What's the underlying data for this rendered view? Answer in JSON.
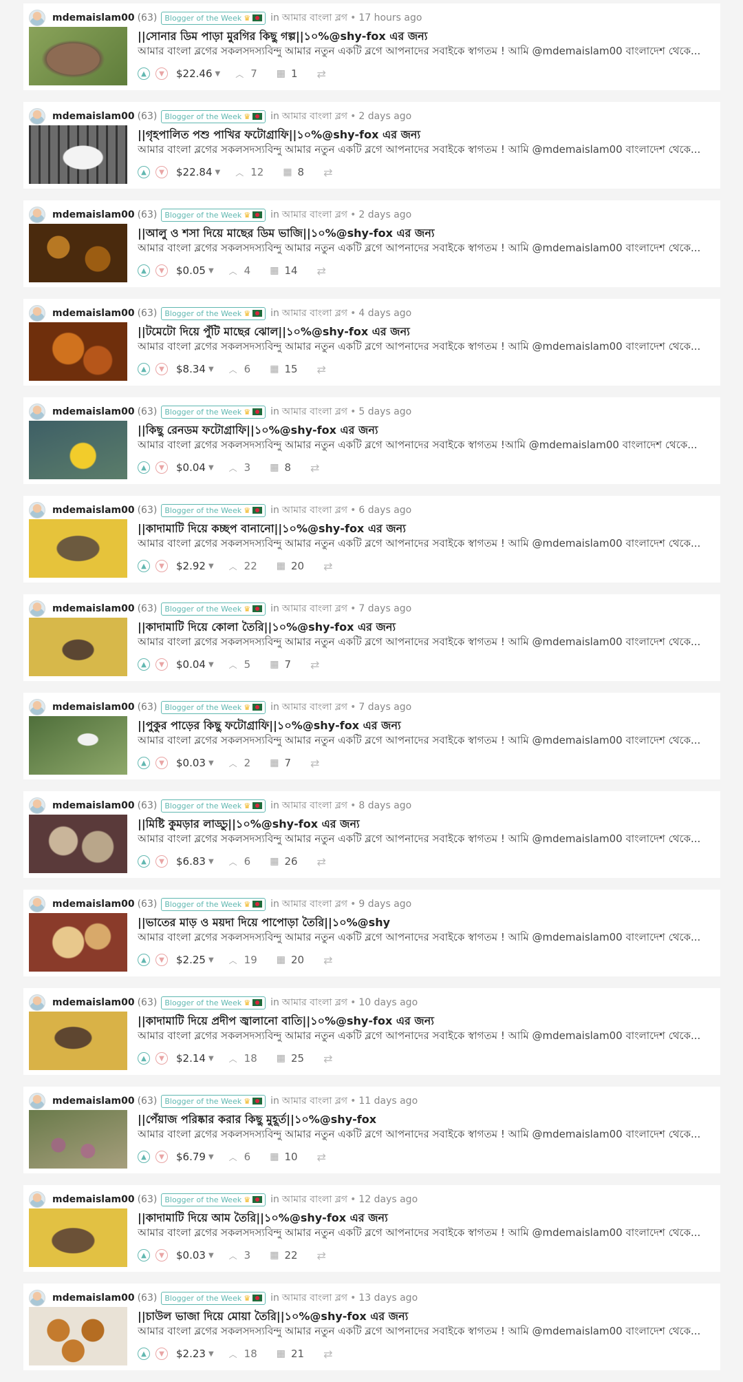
{
  "colors": {
    "accent": "#5fb7b0",
    "downvote": "#e9a5a5",
    "background": "#f4f4f4"
  },
  "icons": {
    "upvote": "chevron-up-icon",
    "downvote": "chevron-down-icon",
    "comments": "comment-icon",
    "reblog": "reblog-icon"
  },
  "posts": [
    {
      "author": "mdemaislam00",
      "rep": "(63)",
      "badge": "Blogger of the Week",
      "in": "in",
      "community": "আমার বাংলা ব্লগ",
      "time": "17 hours ago",
      "title": "||সোনার ডিম পাড়া মুরগির কিছু গল্প||১০%@shy-fox এর জন্য",
      "summary": "আমার বাংলা ব্লগের সকলসদস্যবিন্দু আমার নতুন একটি ব্লগে আপনাদের সবাইকে স্বাগতম ! আমি @mdemaislam00 বাংলাদেশ থেকে...",
      "payout": "$22.46",
      "votes": "7",
      "comments": "1"
    },
    {
      "author": "mdemaislam00",
      "rep": "(63)",
      "badge": "Blogger of the Week",
      "in": "in",
      "community": "আমার বাংলা ব্লগ",
      "time": "2 days ago",
      "title": "||গৃহপালিত পশু পাখির ফটোগ্রাফি||১০%@shy-fox এর জন্য",
      "summary": "আমার বাংলা ব্লগের সকলসদস্যবিন্দু আমার নতুন একটি ব্লগে আপনাদের সবাইকে স্বাগতম ! আমি @mdemaislam00 বাংলাদেশ থেকে...",
      "payout": "$22.84",
      "votes": "12",
      "comments": "8"
    },
    {
      "author": "mdemaislam00",
      "rep": "(63)",
      "badge": "Blogger of the Week",
      "in": "in",
      "community": "আমার বাংলা ব্লগ",
      "time": "2 days ago",
      "title": "||আলু ও শসা দিয়ে মাছের ডিম ভাজি||১০%@shy-fox এর জন্য",
      "summary": "আমার বাংলা ব্লগের সকলসদস্যবিন্দু আমার নতুন একটি ব্লগে আপনাদের সবাইকে স্বাগতম ! আমি @mdemaislam00 বাংলাদেশ থেকে...",
      "payout": "$0.05",
      "votes": "4",
      "comments": "14"
    },
    {
      "author": "mdemaislam00",
      "rep": "(63)",
      "badge": "Blogger of the Week",
      "in": "in",
      "community": "আমার বাংলা ব্লগ",
      "time": "4 days ago",
      "title": "||টমেটো দিয়ে পুঁটি মাছের ঝোল||১০%@shy-fox এর জন্য",
      "summary": "আমার বাংলা ব্লগের সকলসদস্যবিন্দু আমার নতুন একটি ব্লগে আপনাদের সবাইকে স্বাগতম ! আমি @mdemaislam00 বাংলাদেশ থেকে...",
      "payout": "$8.34",
      "votes": "6",
      "comments": "15"
    },
    {
      "author": "mdemaislam00",
      "rep": "(63)",
      "badge": "Blogger of the Week",
      "in": "in",
      "community": "আমার বাংলা ব্লগ",
      "time": "5 days ago",
      "title": "||কিছু রেনডম ফটোগ্রাফি||১০%@shy-fox এর জন্য",
      "summary": "আমার বাংলা ব্লগের সকলসদস্যবিন্দু আমার নতুন একটি ব্লগে আপনাদের সবাইকে স্বাগতম !আমি @mdemaislam00 বাংলাদেশ থেকে...",
      "payout": "$0.04",
      "votes": "3",
      "comments": "8"
    },
    {
      "author": "mdemaislam00",
      "rep": "(63)",
      "badge": "Blogger of the Week",
      "in": "in",
      "community": "আমার বাংলা ব্লগ",
      "time": "6 days ago",
      "title": "||কাদামাটি দিয়ে কচ্ছপ বানানো||১০%@shy-fox এর জন্য",
      "summary": "আমার বাংলা ব্লগের সকলসদস্যবিন্দু আমার নতুন একটি ব্লগে আপনাদের সবাইকে স্বাগতম ! আমি @mdemaislam00 বাংলাদেশ থেকে...",
      "payout": "$2.92",
      "votes": "22",
      "comments": "20"
    },
    {
      "author": "mdemaislam00",
      "rep": "(63)",
      "badge": "Blogger of the Week",
      "in": "in",
      "community": "আমার বাংলা ব্লগ",
      "time": "7 days ago",
      "title": "||কাদামাটি দিয়ে কোলা তৈরি||১০%@shy-fox এর জন্য",
      "summary": "আমার বাংলা ব্লগের সকলসদস্যবিন্দু আমার নতুন একটি ব্লগে আপনাদের সবাইকে স্বাগতম ! আমি @mdemaislam00 বাংলাদেশ থেকে...",
      "payout": "$0.04",
      "votes": "5",
      "comments": "7"
    },
    {
      "author": "mdemaislam00",
      "rep": "(63)",
      "badge": "Blogger of the Week",
      "in": "in",
      "community": "আমার বাংলা ব্লগ",
      "time": "7 days ago",
      "title": "||পুকুর পাড়ের কিছু ফটোগ্রাফি||১০%@shy-fox এর জন্য",
      "summary": "আমার বাংলা ব্লগের সকলসদস্যবিন্দু আমার নতুন একটি ব্লগে আপনাদের সবাইকে স্বাগতম ! আমি @mdemaislam00 বাংলাদেশ থেকে...",
      "payout": "$0.03",
      "votes": "2",
      "comments": "7"
    },
    {
      "author": "mdemaislam00",
      "rep": "(63)",
      "badge": "Blogger of the Week",
      "in": "in",
      "community": "আমার বাংলা ব্লগ",
      "time": "8 days ago",
      "title": "||মিষ্টি কুমড়ার লাড্ডু||১০%@shy-fox এর জন্য",
      "summary": "আমার বাংলা ব্লগের সকলসদস্যবিন্দু আমার নতুন একটি ব্লগে আপনাদের সবাইকে স্বাগতম ! আমি @mdemaislam00 বাংলাদেশ থেকে...",
      "payout": "$6.83",
      "votes": "6",
      "comments": "26"
    },
    {
      "author": "mdemaislam00",
      "rep": "(63)",
      "badge": "Blogger of the Week",
      "in": "in",
      "community": "আমার বাংলা ব্লগ",
      "time": "9 days ago",
      "title": "||ভাতের মাড় ও ময়দা দিয়ে পাপোড়া তৈরি||১০%@shy",
      "summary": "আমার বাংলা ব্লগের সকলসদস্যবিন্দু আমার নতুন একটি ব্লগে আপনাদের সবাইকে স্বাগতম ! আমি @mdemaislam00 বাংলাদেশ থেকে...",
      "payout": "$2.25",
      "votes": "19",
      "comments": "20"
    },
    {
      "author": "mdemaislam00",
      "rep": "(63)",
      "badge": "Blogger of the Week",
      "in": "in",
      "community": "আমার বাংলা ব্লগ",
      "time": "10 days ago",
      "title": "||কাদামাটি দিয়ে প্রদীপ জ্বালানো বাতি||১০%@shy-fox এর জন্য",
      "summary": "আমার বাংলা ব্লগের সকলসদস্যবিন্দু আমার নতুন একটি ব্লগে আপনাদের সবাইকে স্বাগতম ! আমি @mdemaislam00 বাংলাদেশ থেকে...",
      "payout": "$2.14",
      "votes": "18",
      "comments": "25"
    },
    {
      "author": "mdemaislam00",
      "rep": "(63)",
      "badge": "Blogger of the Week",
      "in": "in",
      "community": "আমার বাংলা ব্লগ",
      "time": "11 days ago",
      "title": "||পেঁয়াজ পরিষ্কার করার কিছু মুহূর্ত||১০%@shy-fox",
      "summary": "আমার বাংলা ব্লগের সকলসদস্যবিন্দু আমার নতুন একটি ব্লগে আপনাদের সবাইকে স্বাগতম ! আমি @mdemaislam00 বাংলাদেশ থেকে...",
      "payout": "$6.79",
      "votes": "6",
      "comments": "10"
    },
    {
      "author": "mdemaislam00",
      "rep": "(63)",
      "badge": "Blogger of the Week",
      "in": "in",
      "community": "আমার বাংলা ব্লগ",
      "time": "12 days ago",
      "title": "||কাদামাটি দিয়ে আম তৈরি||১০%@shy-fox এর জন্য",
      "summary": "আমার বাংলা ব্লগের সকলসদস্যবিন্দু আমার নতুন একটি ব্লগে আপনাদের সবাইকে স্বাগতম ! আমি @mdemaislam00 বাংলাদেশ থেকে...",
      "payout": "$0.03",
      "votes": "3",
      "comments": "22"
    },
    {
      "author": "mdemaislam00",
      "rep": "(63)",
      "badge": "Blogger of the Week",
      "in": "in",
      "community": "আমার বাংলা ব্লগ",
      "time": "13 days ago",
      "title": "||চাউল ভাজা দিয়ে মোয়া তৈরি||১০%@shy-fox এর জন্য",
      "summary": "আমার বাংলা ব্লগের সকলসদস্যবিন্দু আমার নতুন একটি ব্লগে আপনাদের সবাইকে স্বাগতম ! আমি @mdemaislam00 বাংলাদেশ থেকে...",
      "payout": "$2.23",
      "votes": "18",
      "comments": "21"
    }
  ]
}
